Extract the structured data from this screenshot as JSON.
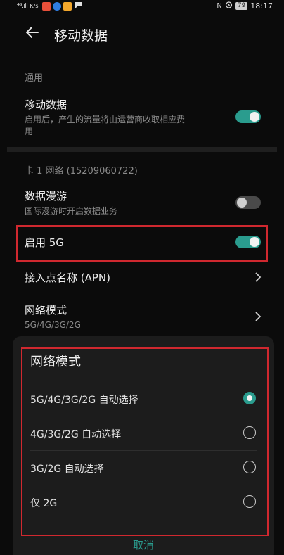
{
  "status_bar": {
    "network": "⁴ᴳ.ıll",
    "speed": "K/s",
    "nfc": "N",
    "battery": "79",
    "time": "18:17",
    "app_colors": [
      "#e8503a",
      "#2f7de1",
      "#f2a72c"
    ]
  },
  "header": {
    "title": "移动数据",
    "back_icon": "arrow-left-icon"
  },
  "general": {
    "section_label": "通用",
    "mobile_data": {
      "title": "移动数据",
      "subtitle_line1": "启用后，产生的流量将由运营商收取相应费",
      "subtitle_line2": "用",
      "enabled": true
    }
  },
  "sim": {
    "section_label": "卡 1 网络 (15209060722)",
    "roaming": {
      "title": "数据漫游",
      "subtitle": "国际漫游时开启数据业务",
      "enabled": false
    },
    "enable_5g": {
      "title": "启用 5G",
      "enabled": true
    },
    "apn": {
      "title": "接入点名称 (APN)"
    },
    "network_mode": {
      "title": "网络模式",
      "subtitle": "5G/4G/3G/2G"
    }
  },
  "dialog": {
    "title": "网络模式",
    "options": [
      {
        "label": "5G/4G/3G/2G 自动选择",
        "selected": true
      },
      {
        "label": "4G/3G/2G 自动选择",
        "selected": false
      },
      {
        "label": "3G/2G 自动选择",
        "selected": false
      },
      {
        "label": "仅 2G",
        "selected": false
      }
    ],
    "cancel_label": "取消"
  },
  "colors": {
    "accent": "#2a9c8e",
    "highlight": "#d0282f"
  }
}
